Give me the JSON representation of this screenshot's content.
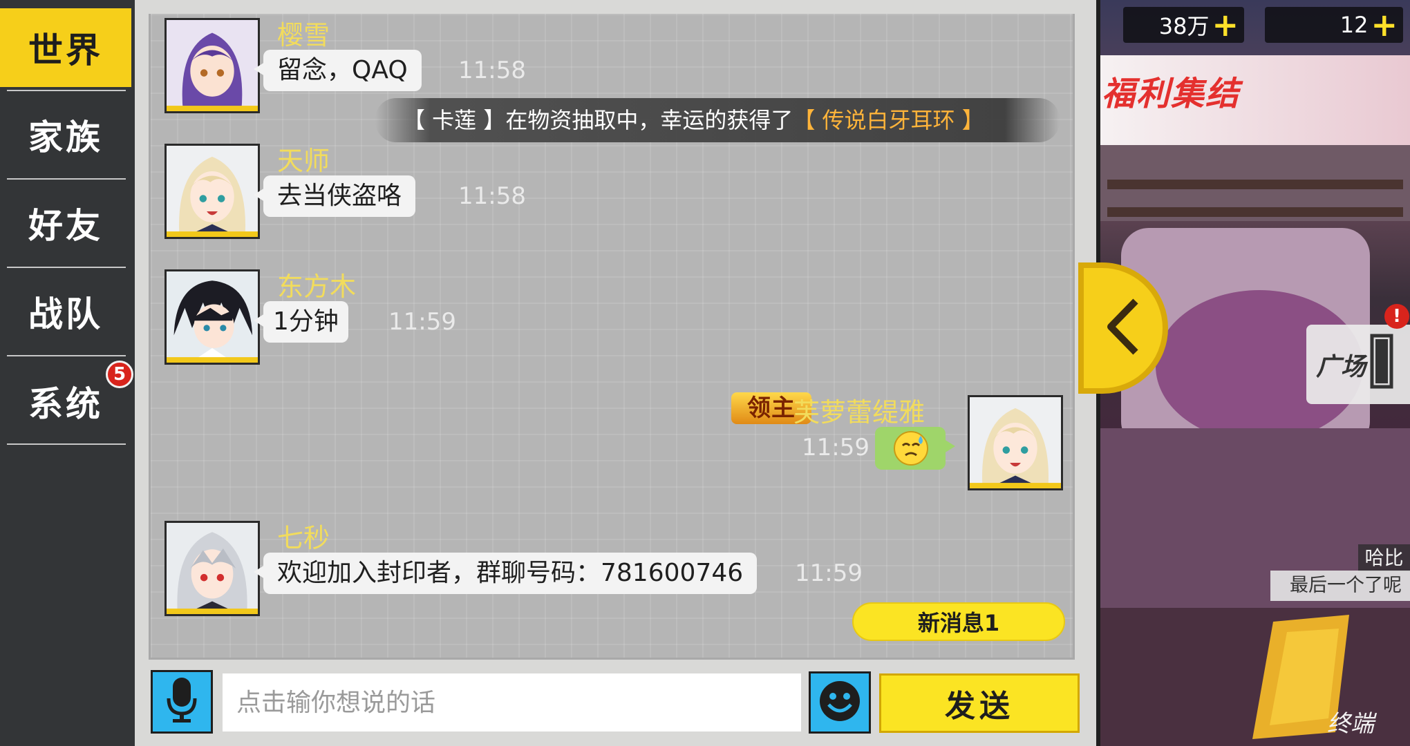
{
  "tabs": [
    {
      "label": "世界"
    },
    {
      "label": "家族"
    },
    {
      "label": "好友"
    },
    {
      "label": "战队"
    },
    {
      "label": "系统"
    }
  ],
  "system_badge": "5",
  "messages": [
    {
      "user": "樱雪",
      "text": "留念，QAQ",
      "time": "11:58"
    },
    {
      "user": "天师",
      "text": "去当侠盗咯",
      "time": "11:58"
    },
    {
      "user": "东方木",
      "text": "1分钟",
      "time": "11:59"
    },
    {
      "user": "芙萝蕾缇雅",
      "tag": "领主",
      "time": "11:59",
      "emoji": "sweat-smile-emoji"
    },
    {
      "user": "七秒",
      "text": "欢迎加入封印者，群聊号码：781600746",
      "time": "11:59"
    }
  ],
  "system_message": {
    "prefix": "【 卡莲 】在物资抽取中，幸运的获得了",
    "item": "【 传说白牙耳环 】"
  },
  "new_message_label": "新消息1",
  "input": {
    "placeholder": "点击输你想说的话",
    "value": ""
  },
  "send_label": "发送",
  "resources": {
    "gold": "38万",
    "gems": "12"
  },
  "scene": {
    "banner": "福利集结",
    "plaza": "广场",
    "alert": "!",
    "npc_name": "哈比",
    "npc_line": "最后一个了呢",
    "terminal": "终端"
  },
  "colors": {
    "accent": "#f6cf1a",
    "name": "#f2dc5c",
    "highlight": "#ffb43a",
    "button_blue": "#2fb6ee"
  }
}
